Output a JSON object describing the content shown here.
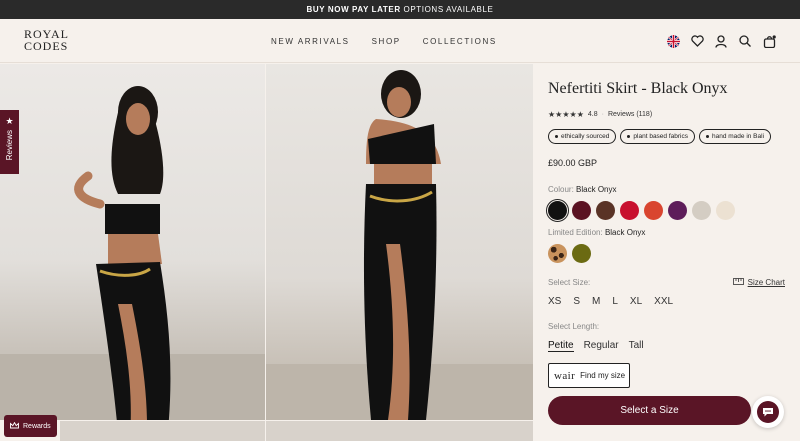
{
  "promo": {
    "bold": "BUY NOW PAY LATER",
    "rest": "OPTIONS AVAILABLE"
  },
  "header": {
    "logo_line1": "ROYAL",
    "logo_line2": "CODES",
    "nav": [
      "NEW ARRIVALS",
      "SHOP",
      "COLLECTIONS"
    ],
    "icons": [
      "uk-flag-icon",
      "wishlist-heart-icon",
      "account-icon",
      "search-icon",
      "cart-bag-icon"
    ]
  },
  "reviews_tab": {
    "label": "Reviews"
  },
  "rewards": {
    "label": "Rewards"
  },
  "product": {
    "title": "Nefertiti Skirt - Black Onyx",
    "rating_value": "4.8",
    "reviews_label": "Reviews (118)",
    "badges": [
      "ethically sourced",
      "plant based fabrics",
      "hand made in Bali"
    ],
    "price": "£90.00 GBP",
    "colour_label": "Colour:",
    "colour_value": "Black Onyx",
    "colour_swatches": [
      "#111111",
      "#5b1222",
      "#5a3326",
      "#c8102e",
      "#d9452f",
      "#5e1d5a",
      "#d4cdc3",
      "#ece1d2"
    ],
    "limited_label": "Limited Edition:",
    "limited_value": "Black Onyx",
    "limited_swatches": [
      "leopard",
      "#6b6a12"
    ],
    "size_label": "Select Size:",
    "size_chart": "Size Chart",
    "sizes": [
      "XS",
      "S",
      "M",
      "L",
      "XL",
      "XXL"
    ],
    "length_label": "Select Length:",
    "lengths": [
      "Petite",
      "Regular",
      "Tall"
    ],
    "selected_length": "Petite",
    "fit_logo": "wair",
    "fit_label": "Find my size",
    "cta": "Select a Size"
  },
  "colors": {
    "accent": "#5a1526",
    "background": "#f6f1ec",
    "promo_bar": "#2a2a2a"
  }
}
